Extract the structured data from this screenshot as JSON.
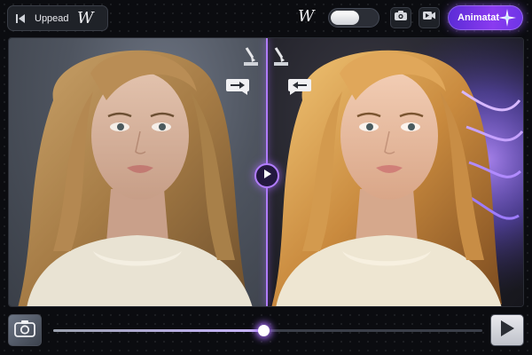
{
  "toolbar": {
    "upload_label": "Uppead",
    "logo_glyph": "W",
    "logo_glyph_secondary": "W",
    "toggle_state": "off",
    "animate_label": "Animatat",
    "icons": [
      "back-arrow-icon",
      "camera-icon",
      "video-icon",
      "sparkle-icon"
    ]
  },
  "canvas": {
    "mode": "before-after-compare",
    "split_position": 0.5,
    "left_tools": [
      "brush-stroke-icon",
      "arrow-right-icon"
    ],
    "right_tools": [
      "brush-stroke-icon",
      "arrow-left-icon"
    ],
    "handle_icon": "play-icon"
  },
  "timeline": {
    "progress": 0.49,
    "thumbnail_icon": "camera-icon",
    "play_icon": "play-icon"
  },
  "colors": {
    "accent": "#8a3bf0",
    "accent_glow": "#b07cff",
    "background": "#0b0c10",
    "panel": "#1f2228"
  }
}
